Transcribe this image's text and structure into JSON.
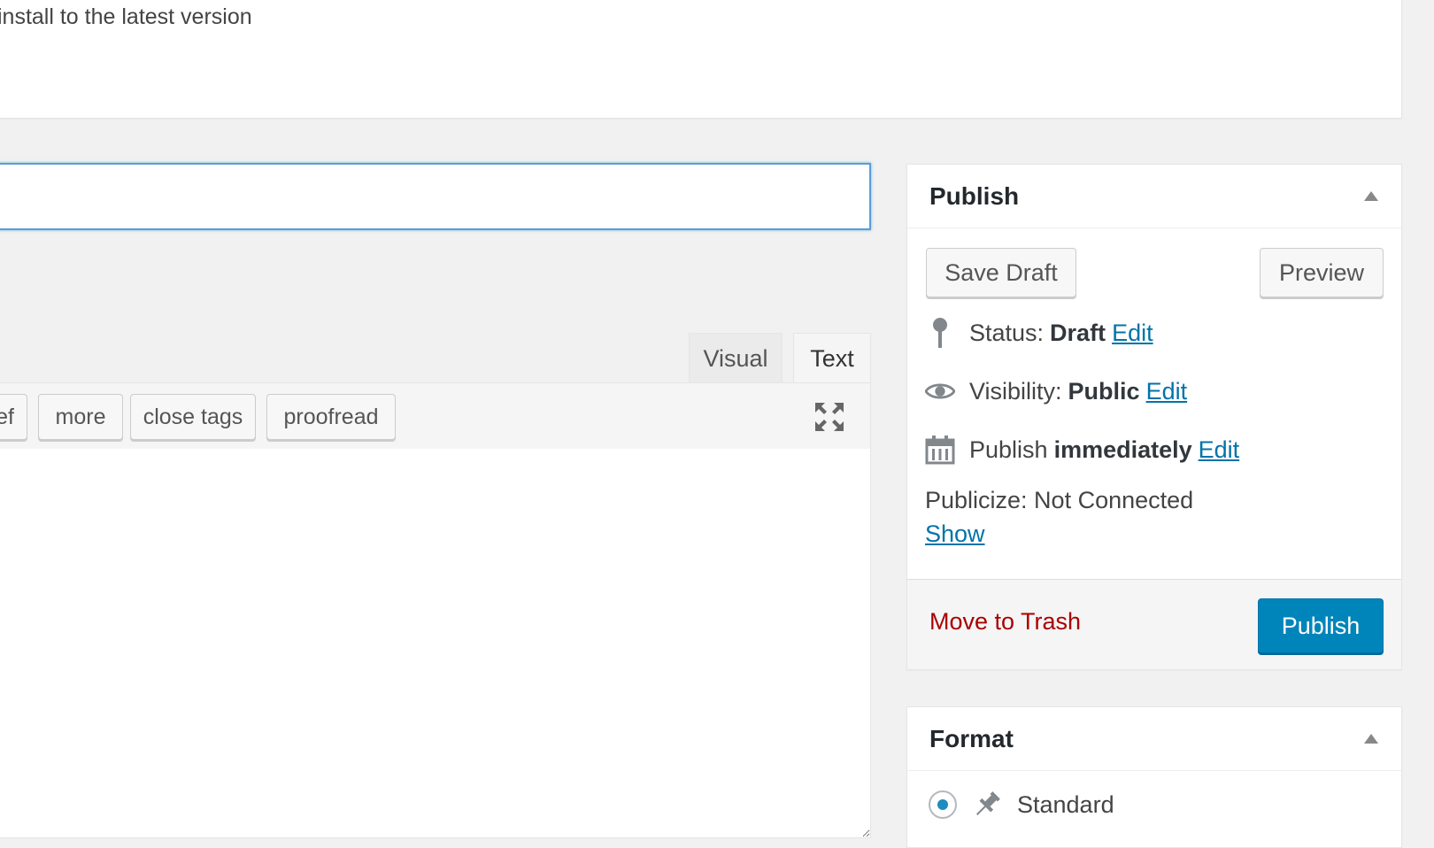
{
  "notice": {
    "text": "install to the latest version"
  },
  "title_field": {
    "value": ""
  },
  "editor": {
    "tabs": [
      {
        "label": "Visual",
        "active": false
      },
      {
        "label": "Text",
        "active": true
      }
    ],
    "quicktags": [
      "ef",
      "more",
      "close tags",
      "proofread"
    ],
    "content": ""
  },
  "publish_box": {
    "title": "Publish",
    "save_draft_label": "Save Draft",
    "preview_label": "Preview",
    "status_label": "Status:",
    "status_value": "Draft",
    "visibility_label": "Visibility:",
    "visibility_value": "Public",
    "publish_label": "Publish",
    "publish_value": "immediately",
    "edit_label": "Edit",
    "publicize_text": "Publicize: Not Connected",
    "show_link": "Show",
    "trash_label": "Move to Trash",
    "publish_button": "Publish"
  },
  "format_box": {
    "title": "Format",
    "options": [
      {
        "label": "Standard",
        "selected": true
      }
    ]
  },
  "colors": {
    "accent": "#0085ba",
    "link": "#0073aa",
    "trash": "#aa0000",
    "focus": "#5b9dd9"
  }
}
